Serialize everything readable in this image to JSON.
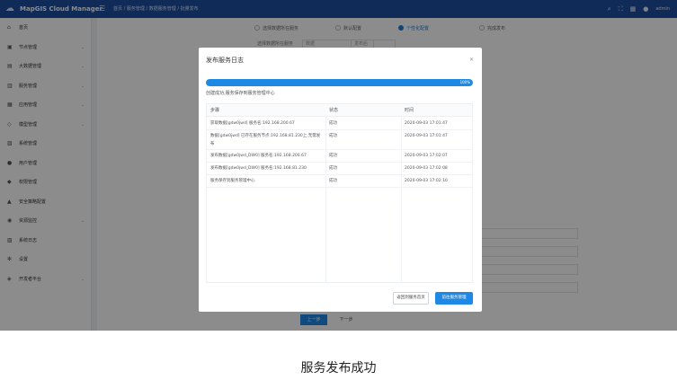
{
  "app": {
    "title": "MapGIS Cloud Manager"
  },
  "topbar": {
    "breadcrumb": "首页 / 服务管理 / 数据服务管理 / 批量发布",
    "icons": [
      "search-icon",
      "expand-icon",
      "grid-icon",
      "user-icon"
    ],
    "user": "admin"
  },
  "sidebar": {
    "items": [
      {
        "label": "首页",
        "icon": "home-icon",
        "chevron": false
      },
      {
        "label": "节点管理",
        "icon": "node-icon",
        "chevron": true
      },
      {
        "label": "大数据管理",
        "icon": "bigdata-icon",
        "chevron": true
      },
      {
        "label": "服务管理",
        "icon": "service-icon",
        "chevron": true
      },
      {
        "label": "应用管理",
        "icon": "app-icon",
        "chevron": true
      },
      {
        "label": "模型管理",
        "icon": "model-icon",
        "chevron": true
      },
      {
        "label": "系统管理",
        "icon": "system-icon",
        "chevron": false
      },
      {
        "label": "用户管理",
        "icon": "user-icon",
        "chevron": false
      },
      {
        "label": "权限管理",
        "icon": "permission-icon",
        "chevron": false
      },
      {
        "label": "安全策略配置",
        "icon": "security-icon",
        "chevron": false
      },
      {
        "label": "资源监控",
        "icon": "monitor-icon",
        "chevron": true
      },
      {
        "label": "系统日志",
        "icon": "log-icon",
        "chevron": false
      },
      {
        "label": "设置",
        "icon": "settings-icon",
        "chevron": false
      },
      {
        "label": "开发者平台",
        "icon": "developer-icon",
        "chevron": true
      }
    ]
  },
  "steps": [
    {
      "label": "选择数据所在服务",
      "active": false
    },
    {
      "label": "默认配置",
      "active": false
    },
    {
      "label": "个性化配置",
      "active": true
    },
    {
      "label": "完成发布",
      "active": false
    }
  ],
  "background_form": {
    "label": "选择数据所在服务",
    "select_value": "数据",
    "field_value": "发布后"
  },
  "background_buttons": {
    "prev": "上一步",
    "next": "下一步"
  },
  "modal": {
    "title": "发布服务日志",
    "progress_value": 100,
    "progress_label": "100%",
    "status_text": "创建成功,服务保存到服务管理中心",
    "columns": [
      "步骤",
      "状态",
      "时间"
    ],
    "rows": [
      {
        "step": "获取数据[gdw0jwd] 服务名:192.168.200.67",
        "status": "成功",
        "time": "2020-09-03 17:01:47"
      },
      {
        "step": "数据[gdw0jwd] 已存在服务节点:192.168.81.230上,无需发布",
        "status": "成功",
        "time": "2020-09-03 17:01:47"
      },
      {
        "step": "发布数据[gdw0jwd_DW0] 服务名:192.168.200.67",
        "status": "成功",
        "time": "2020-09-03 17:02:07"
      },
      {
        "step": "发布数据[gdw0jwd_DW0] 服务名:192.168.81.230",
        "status": "成功",
        "time": "2020-09-03 17:02:08"
      },
      {
        "step": "服务保存到服务管理中心",
        "status": "成功",
        "time": "2020-09-03 17:02:10"
      }
    ],
    "buttons": {
      "back": "返回到服务首页",
      "go": "前往服务管理"
    }
  },
  "caption": "服务发布成功",
  "colors": {
    "topbar": "#1f4fa3",
    "accent": "#1e88e5"
  }
}
